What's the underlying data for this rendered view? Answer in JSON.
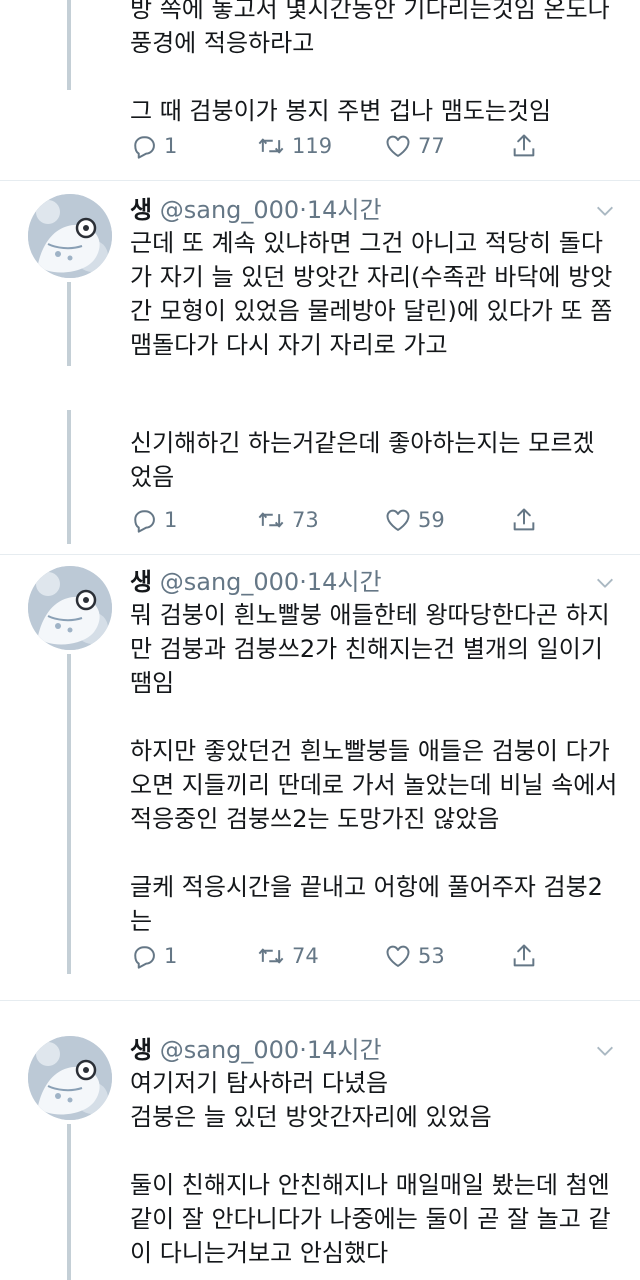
{
  "top_tweet": {
    "lines": [
      "방 쪽에 놓고서 몇시간동안 기다리는것임 온도나",
      "풍경에 적응하라고",
      "",
      "그 때 검붕이가 봉지 주변 겁나 맴도는것임"
    ],
    "replies": "1",
    "retweets": "119",
    "likes": "77"
  },
  "tweet2": {
    "name": "생",
    "handle": "@sang_000",
    "time": "14시간",
    "lines": [
      "근데 또 계속 있냐하면 그건 아니고 적당히 돌다",
      "가 자기 늘 있던 방앗간 자리(수족관 바닥에 방앗",
      "간 모형이 있었음 물레방아 달린)에 있다가 또 쫌",
      "맴돌다가 다시 자기 자리로 가고"
    ],
    "lines2": [
      "신기해하긴 하는거같은데 좋아하는지는 모르겠",
      "었음"
    ],
    "replies": "1",
    "retweets": "73",
    "likes": "59"
  },
  "tweet3": {
    "name": "생",
    "handle": "@sang_000",
    "time": "14시간",
    "lines": [
      "뭐 검붕이 흰노빨붕 애들한테 왕따당한다곤 하지",
      "만 검붕과 검붕쓰2가 친해지는건 별개의 일이기",
      "땜임",
      "",
      "하지만 좋았던건 흰노빨붕들 애들은 검붕이 다가",
      "오면 지들끼리 딴데로 가서 놀았는데 비닐 속에서",
      "적응중인 검붕쓰2는 도망가진 않았음",
      "",
      "글케 적응시간을 끝내고 어항에 풀어주자 검붕2",
      "는"
    ],
    "replies": "1",
    "retweets": "74",
    "likes": "53"
  },
  "tweet4": {
    "name": "생",
    "handle": "@sang_000",
    "time": "14시간",
    "lines": [
      "여기저기 탐사하러 다녔음",
      "검붕은 늘 있던 방앗간자리에 있었음",
      "",
      "둘이 친해지나 안친해지나 매일매일 봤는데 첨엔",
      "같이 잘 안다니다가 나중에는 둘이 곧 잘 놀고 같",
      "이 다니는거보고 안심했다"
    ]
  },
  "icons": {
    "reply": "reply-icon",
    "retweet": "retweet-icon",
    "like": "heart-icon",
    "share": "share-icon",
    "menu": "chevron-down-icon"
  },
  "colors": {
    "text": "#14171a",
    "secondary": "#657786",
    "thread_line": "#c4cfd6"
  }
}
